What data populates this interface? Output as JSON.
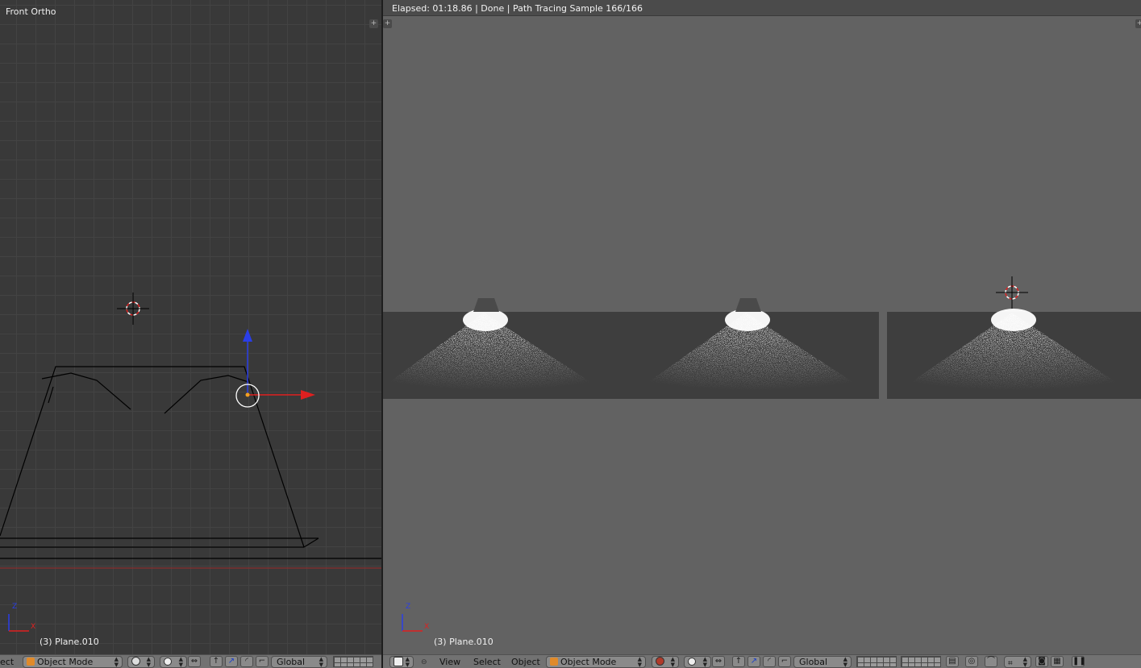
{
  "left_viewport": {
    "view_label": "Front Ortho",
    "object_info": "(3) Plane.010"
  },
  "right_viewport": {
    "render_status": "Elapsed: 01:18.86 | Done | Path Tracing Sample 166/166",
    "object_info": "(3) Plane.010"
  },
  "left_header": {
    "menu_cutoff": "ect",
    "mode": "Object Mode",
    "orientation": "Global"
  },
  "right_header": {
    "menu_view": "View",
    "menu_select": "Select",
    "menu_object": "Object",
    "mode": "Object Mode",
    "orientation": "Global"
  },
  "axis_labels": {
    "z": "Z",
    "x": "X"
  },
  "colors": {
    "viewport_bg": "#393939",
    "render_bg": "#626262",
    "header_bg": "#727272",
    "axis_x": "#e02020",
    "axis_z": "#2a3ee8",
    "orange_mode_icon": "#e08a2a"
  }
}
